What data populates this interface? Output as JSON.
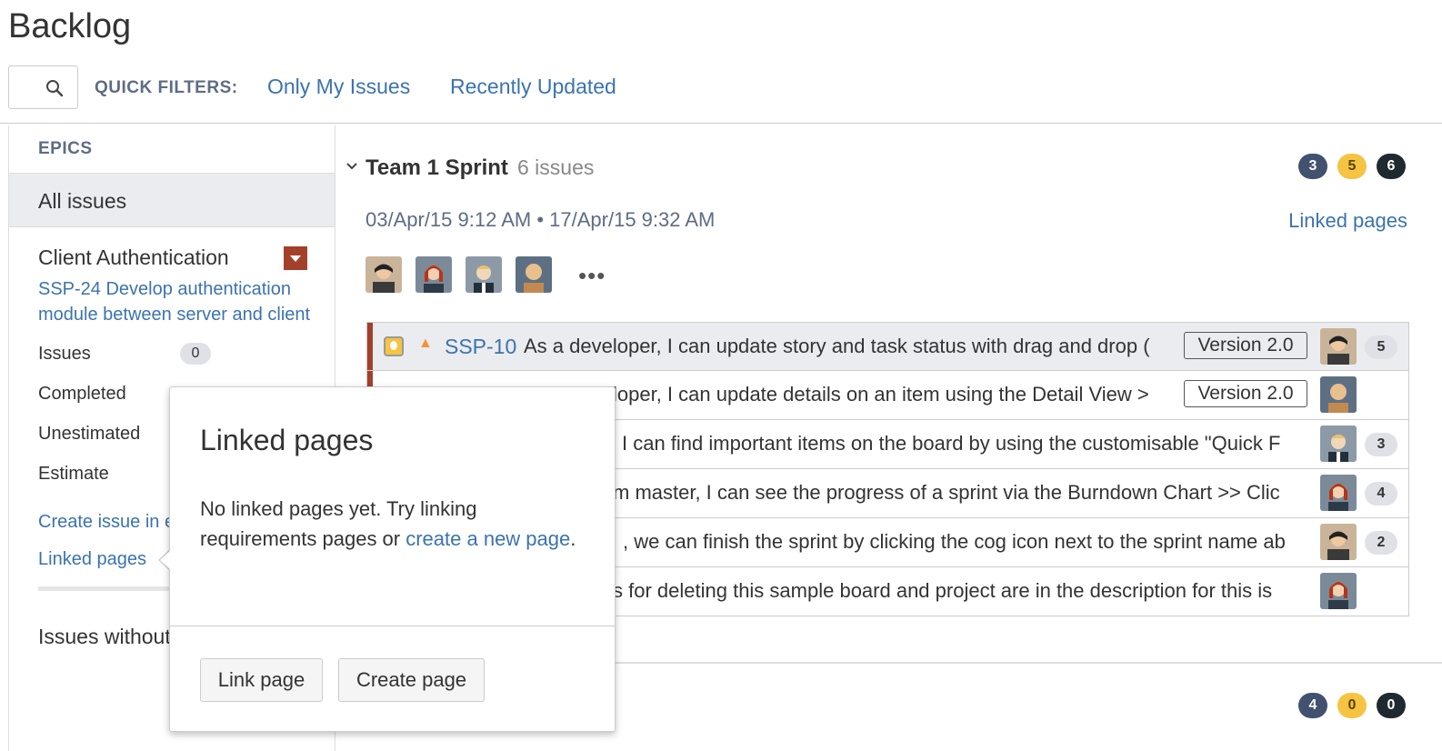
{
  "page": {
    "title": "Backlog"
  },
  "toolbar": {
    "quick_filters_label": "QUICK FILTERS:",
    "filters": [
      "Only My Issues",
      "Recently Updated"
    ]
  },
  "sidebar": {
    "epics_label": "EPICS",
    "all_issues": "All issues",
    "epic": {
      "title": "Client Authentication",
      "description": "SSP-24 Develop authentication module between server and client",
      "color": "#a3402c"
    },
    "stats": [
      {
        "label": "Issues",
        "value": "0"
      },
      {
        "label": "Completed",
        "value": ""
      },
      {
        "label": "Unestimated",
        "value": ""
      },
      {
        "label": "Estimate",
        "value": ""
      }
    ],
    "create_issue_link": "Create issue in e",
    "linked_pages_link": "Linked pages",
    "issues_without": "Issues without"
  },
  "sprint": {
    "name": "Team 1 Sprint",
    "count": "6 issues",
    "dates": "03/Apr/15 9:12 AM • 17/Apr/15 9:32 AM",
    "linked_pages": "Linked pages",
    "status_counts": [
      "3",
      "5",
      "6"
    ],
    "more": "•••",
    "issues": [
      {
        "key": "SSP-10",
        "summary": "As a developer, I can update story and task status with drag and drop (",
        "version": "Version 2.0",
        "estimate": "5"
      },
      {
        "key": "",
        "summary": "loper, I can update details on an item using the Detail View >",
        "version": "Version 2.0",
        "estimate": ""
      },
      {
        "key": "",
        "summary": "I can find important items on the board by using the customisable \"Quick F",
        "version": "",
        "estimate": "3"
      },
      {
        "key": "",
        "summary": "m master, I can see the progress of a sprint via the Burndown Chart >> Clic",
        "version": "",
        "estimate": "4"
      },
      {
        "key": "",
        "summary": ", we can finish the sprint by clicking the cog icon next to the sprint name ab",
        "version": "",
        "estimate": "2"
      },
      {
        "key": "",
        "summary": "s for deleting this sample board and project are in the description for this is",
        "version": "",
        "estimate": ""
      }
    ]
  },
  "next_sprint": {
    "status_counts": [
      "4",
      "0",
      "0"
    ]
  },
  "popup": {
    "title": "Linked pages",
    "body_text": "No linked pages yet. Try linking requirements pages or ",
    "body_link": "create a new page",
    "body_end": ".",
    "link_button": "Link page",
    "create_button": "Create page"
  }
}
